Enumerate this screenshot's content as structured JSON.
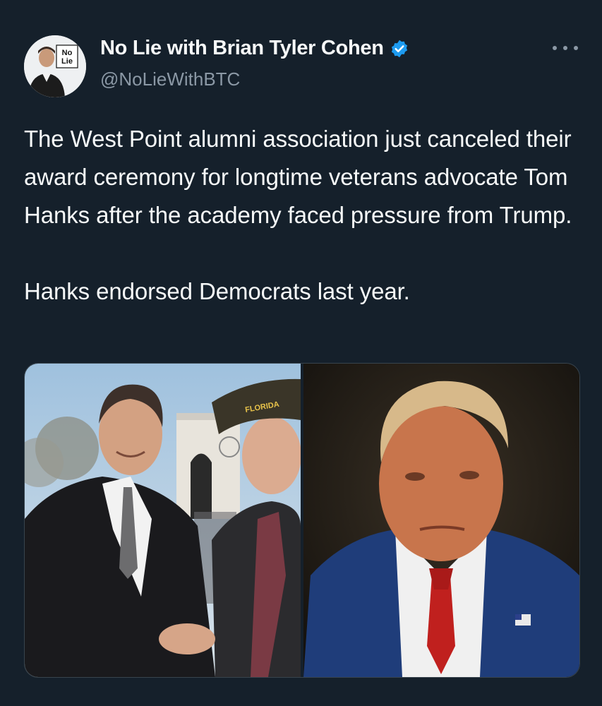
{
  "author": {
    "display_name": "No Lie with Brian Tyler Cohen",
    "handle": "@NoLieWithBTC",
    "verified": true,
    "avatar_logo_text": "No Lie",
    "verified_color": "#1d9bf0"
  },
  "tweet": {
    "paragraphs": [
      "The West Point alumni association just canceled their award ceremony for longtime veterans advocate Tom Hanks after the academy faced pressure from Trump.",
      "Hanks endorsed Democrats last year."
    ]
  },
  "media": {
    "photos": [
      {
        "description_icon": "photo-hanks-veteran",
        "cap_text": "FLORIDA"
      },
      {
        "description_icon": "photo-trump-portrait"
      }
    ]
  },
  "icons": {
    "more": "more-horizontal-icon",
    "verified": "verified-badge-icon"
  },
  "colors": {
    "background": "#15202b",
    "text": "#f7f9f9",
    "secondary": "#8b98a5",
    "border": "#38444d"
  }
}
